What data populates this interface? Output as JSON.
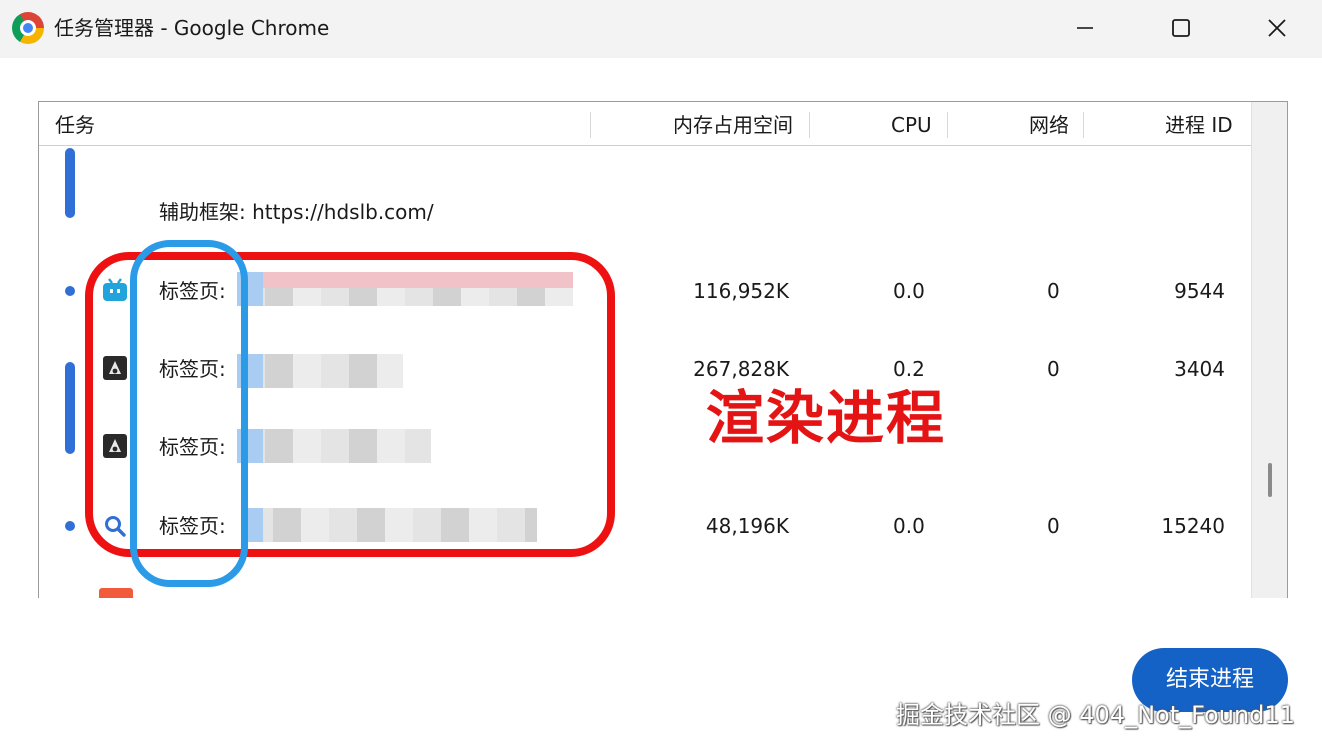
{
  "window": {
    "title": "任务管理器 - Google Chrome",
    "minimize_icon": "minimize-icon",
    "maximize_icon": "maximize-icon",
    "close_icon": "close-icon"
  },
  "table": {
    "columns": [
      "任务",
      "内存占用空间",
      "CPU",
      "网络",
      "进程 ID"
    ],
    "rows": [
      {
        "task": "辅助框架: https://hdslb.com/",
        "memory": "",
        "cpu": "",
        "network": "",
        "pid": ""
      },
      {
        "task": "标签页:",
        "icon": "bilibili-tv-icon",
        "memory": "116,952K",
        "cpu": "0.0",
        "network": "0",
        "pid": "9544"
      },
      {
        "task": "标签页:",
        "icon": "dark-app-icon",
        "memory": "267,828K",
        "cpu": "0.2",
        "network": "0",
        "pid": "3404"
      },
      {
        "task": "标签页:",
        "icon": "dark-app-icon",
        "memory": "",
        "cpu": "",
        "network": "",
        "pid": ""
      },
      {
        "task": "标签页:",
        "icon": "search-icon",
        "memory": "48,196K",
        "cpu": "0.0",
        "network": "0",
        "pid": "15240"
      }
    ]
  },
  "annotation": {
    "label": "渲染进程",
    "color_red": "#ee1111",
    "color_blue": "#2b9be8"
  },
  "actions": {
    "end_process": "结束进程"
  },
  "watermark": "掘金技术社区 @ 404_Not_Found11",
  "colors": {
    "accent": "#1562c6",
    "group_indicator": "#2f6fd6"
  }
}
